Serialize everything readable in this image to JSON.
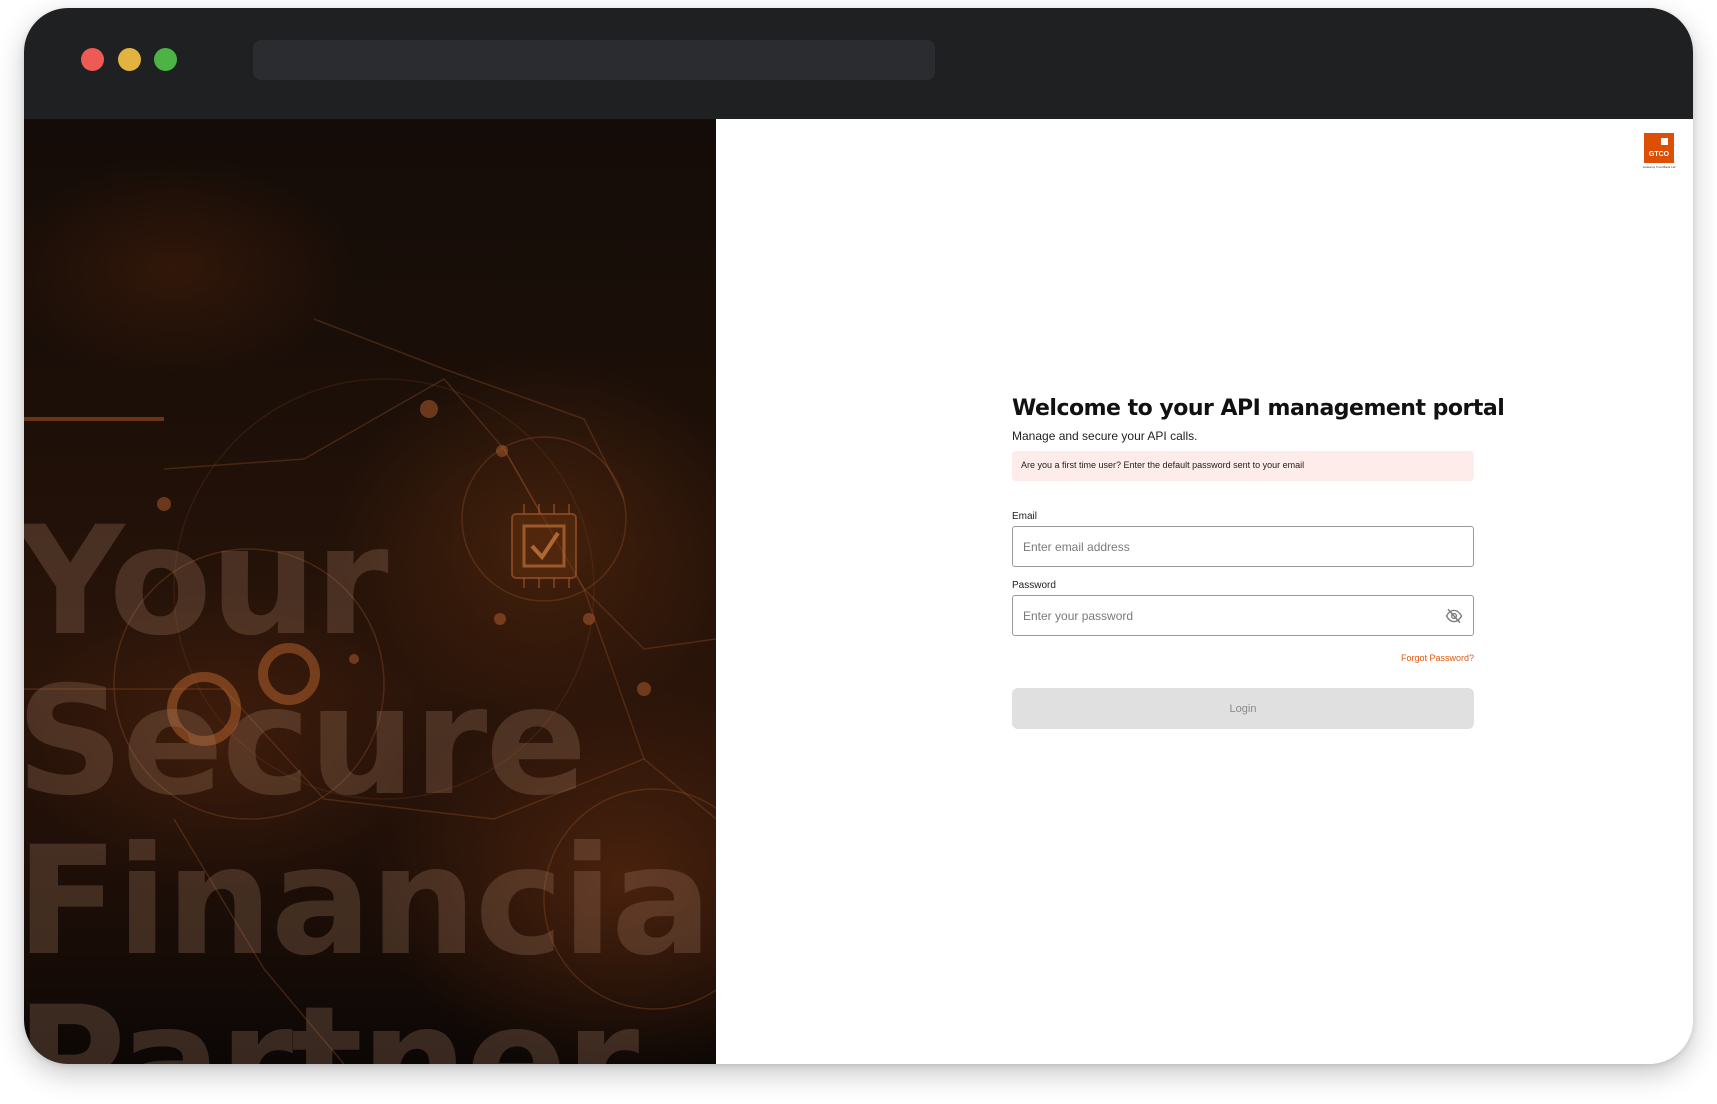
{
  "browser": {
    "controls": [
      "close",
      "minimize",
      "maximize"
    ],
    "address": ""
  },
  "hero": {
    "lines": [
      "Your",
      "Secure",
      "Financial",
      "Partner"
    ]
  },
  "logo": {
    "text": "GTCO",
    "tagline": "Guaranty Trust Bank Ltd"
  },
  "login": {
    "title": "Welcome to your API management portal",
    "subtitle": "Manage and secure your API calls.",
    "notice": "Are you a first time user? Enter the default password sent to your email",
    "email": {
      "label": "Email",
      "placeholder": "Enter email address",
      "value": ""
    },
    "password": {
      "label": "Password",
      "placeholder": "Enter your password",
      "value": ""
    },
    "forgot_label": "Forgot Password?",
    "submit_label": "Login"
  },
  "colors": {
    "brand": "#dd4f05",
    "link": "#e2570c",
    "notice_bg": "#fdecea",
    "button_disabled": "#e0e0e0",
    "titlebar": "#1f2022"
  },
  "icons": [
    "eye-off-icon",
    "chip-check-icon",
    "gear-icon"
  ]
}
